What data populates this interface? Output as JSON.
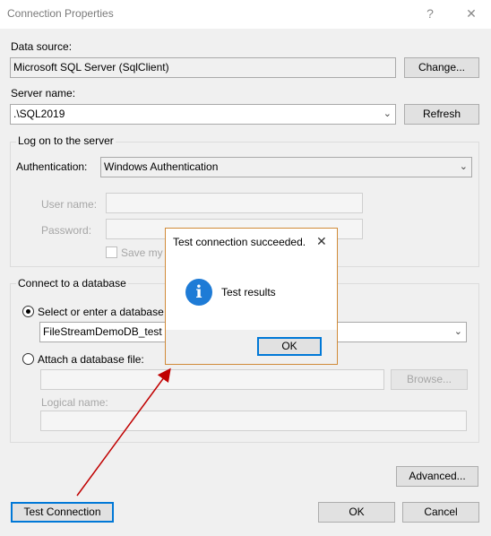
{
  "window": {
    "title": "Connection Properties",
    "help_glyph": "?",
    "close_glyph": "✕"
  },
  "data_source": {
    "label": "Data source:",
    "value": "Microsoft SQL Server (SqlClient)",
    "change_label": "Change..."
  },
  "server": {
    "label": "Server name:",
    "value": ".\\SQL2019",
    "refresh_label": "Refresh"
  },
  "logon": {
    "legend": "Log on to the server",
    "auth_label": "Authentication:",
    "auth_value": "Windows Authentication",
    "user_label": "User name:",
    "password_label": "Password:",
    "save_label": "Save my p"
  },
  "database": {
    "legend": "Connect to a database",
    "select_label": "Select or enter a database n",
    "db_value": "FileStreamDemoDB_test",
    "attach_label": "Attach a database file:",
    "browse_label": "Browse...",
    "logical_label": "Logical name:"
  },
  "buttons": {
    "advanced": "Advanced...",
    "test": "Test Connection",
    "ok": "OK",
    "cancel": "Cancel"
  },
  "message_box": {
    "title": "Test connection succeeded.",
    "close_glyph": "✕",
    "text": "Test results",
    "icon": "info-icon",
    "ok": "OK"
  },
  "colors": {
    "accent": "#0078d7",
    "arrow": "#c00000",
    "msg_border": "#d08a38",
    "info": "#1e7bd6"
  }
}
